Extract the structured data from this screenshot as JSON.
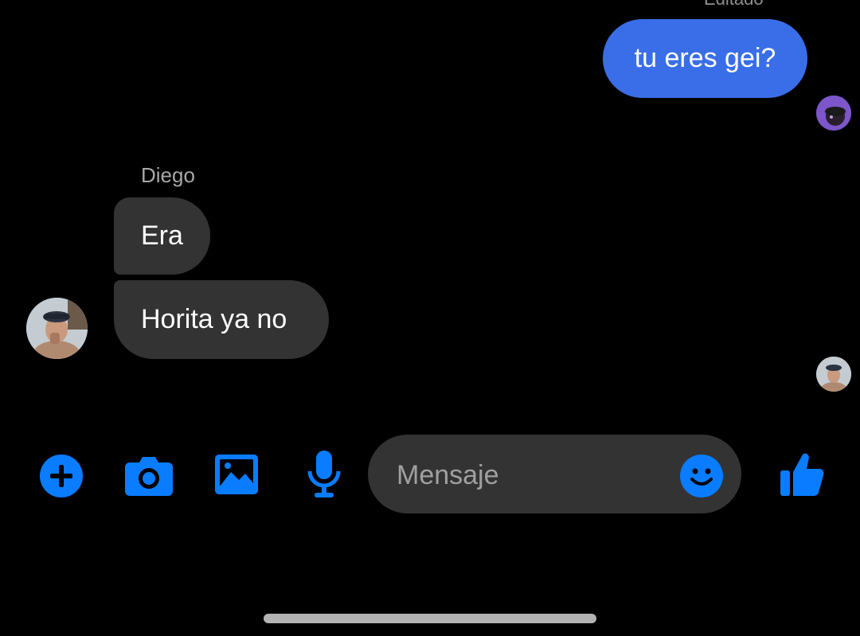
{
  "conversation": {
    "edited_label": "Editado",
    "messages": [
      {
        "direction": "outgoing",
        "text": "tu eres gei?"
      },
      {
        "direction": "incoming",
        "sender": "Diego",
        "text": "Era"
      },
      {
        "direction": "incoming",
        "sender": "Diego",
        "text": "Horita ya no"
      }
    ]
  },
  "composer": {
    "placeholder": "Mensaje"
  },
  "toolbar": {
    "icons": [
      "plus-icon",
      "camera-icon",
      "gallery-icon",
      "microphone-icon",
      "emoji-icon",
      "thumbs-up-icon"
    ]
  },
  "colors": {
    "accent": "#0a7cff",
    "outgoing_bubble": "#3a6ee8",
    "incoming_bubble": "#333333",
    "background": "#000000"
  }
}
